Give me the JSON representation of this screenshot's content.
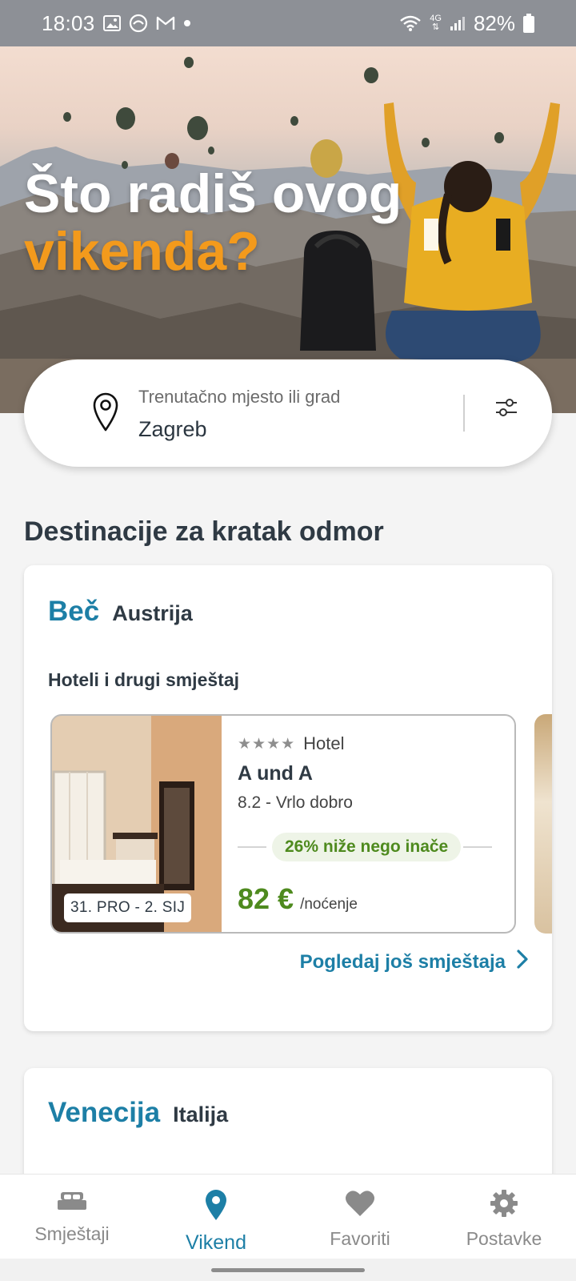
{
  "status_bar": {
    "time": "18:03",
    "battery": "82%",
    "network": "4G"
  },
  "hero": {
    "title_line1": "Što radiš ovog",
    "title_line2": "vikenda?"
  },
  "search": {
    "label": "Trenutačno mjesto ili grad",
    "value": "Zagreb"
  },
  "section_title": "Destinacije za kratak odmor",
  "destinations": [
    {
      "city": "Beč",
      "country": "Austrija",
      "subtitle": "Hoteli i drugi smještaj",
      "hotel": {
        "stars": "★★★★",
        "type": "Hotel",
        "name": "A und A",
        "rating": "8.2 - Vrlo dobro",
        "deal": "26% niže nego inače",
        "price": "82 €",
        "per_night": "/noćenje",
        "dates": "31. PRO - 2. SIJ"
      },
      "more_link": "Pogledaj još smještaja"
    },
    {
      "city": "Venecija",
      "country": "Italija"
    }
  ],
  "bottom_nav": [
    {
      "label": "Smještaji",
      "icon": "bed-icon",
      "active": false
    },
    {
      "label": "Vikend",
      "icon": "location-pin-icon",
      "active": true
    },
    {
      "label": "Favoriti",
      "icon": "heart-icon",
      "active": false
    },
    {
      "label": "Postavke",
      "icon": "gear-icon",
      "active": false
    }
  ],
  "colors": {
    "brand_blue": "#1d7fa6",
    "accent_orange": "#f39a1c",
    "deal_green": "#4e8a1e"
  }
}
